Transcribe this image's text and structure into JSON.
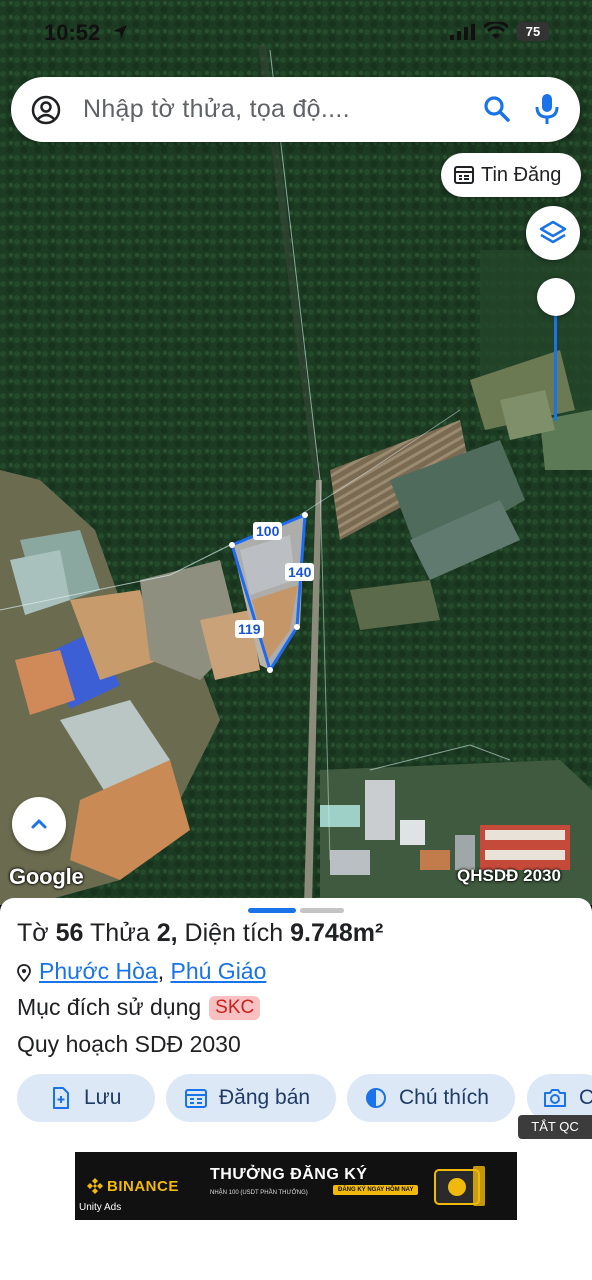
{
  "status_bar": {
    "time": "10:52",
    "battery": "75"
  },
  "search": {
    "placeholder": "Nhập tờ thửa, tọa độ...."
  },
  "tin_dang": {
    "label": "Tin Đăng"
  },
  "map": {
    "plot_labels": [
      "100",
      "140",
      "119"
    ],
    "google_logo": "Google",
    "overlay_label": "QHSDĐ 2030"
  },
  "parcel": {
    "to_label": "Tờ",
    "to_number": "56",
    "thua_label": "Thửa",
    "thua_number": "2,",
    "area_label": "Diện tích",
    "area_value": "9.748m²",
    "ward": "Phước Hòa",
    "separator": ",",
    "district": "Phú Giáo",
    "purpose_label": "Mục đích sử dụng",
    "purpose_code": "SKC",
    "planning": "Quy hoạch SDĐ 2030"
  },
  "actions": {
    "save": "Lưu",
    "post_sale": "Đăng bán",
    "legend": "Chú thích",
    "camera": "C"
  },
  "ad": {
    "close_label": "TẮT QC",
    "brand": "BINANCE",
    "headline": "THƯỞNG ĐĂNG KÝ",
    "subtext": "NHẬN 100 (USDT PHẦN THƯỞNG)",
    "cta": "ĐĂNG KÝ NGAY HÔM NAY",
    "network": "Unity Ads"
  }
}
